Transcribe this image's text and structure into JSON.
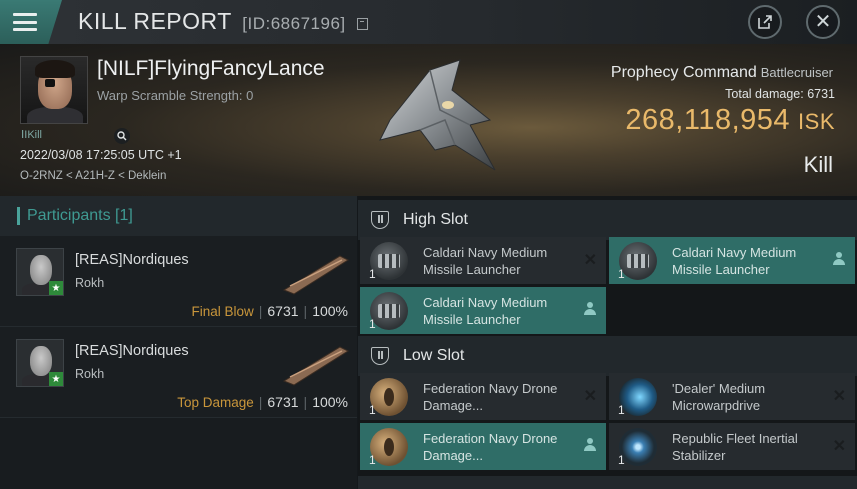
{
  "window": {
    "title": "KILL REPORT",
    "id_text": "[ID:6867196]",
    "icons": {
      "menu": "hamburger-icon",
      "share": "share-icon",
      "close": "close-icon",
      "copy": "copy-icon"
    }
  },
  "victim": {
    "name": "[NILF]FlyingFancyLance",
    "scramble": "Warp Scramble Strength: 0",
    "tag": "Kill",
    "date": "2022/03/08 17:25:05 UTC +1",
    "location": "O-2RNZ < A21H-Z < Deklein",
    "ship_name": "Prophecy Command",
    "ship_class": "Battlecruiser",
    "total_damage_label": "Total damage:",
    "total_damage": "6731",
    "isk_value": "268,118,954",
    "isk_unit": "ISK",
    "result": "Kill"
  },
  "participants": {
    "title": "Participants",
    "count": "[1]",
    "rows": [
      {
        "name": "[REAS]Nordiques",
        "ship": "Rokh",
        "tag": "Final Blow",
        "damage": "6731",
        "percent": "100%"
      },
      {
        "name": "[REAS]Nordiques",
        "ship": "Rokh",
        "tag": "Top Damage",
        "damage": "6731",
        "percent": "100%"
      }
    ]
  },
  "fitting": {
    "high_slot": {
      "title": "High Slot",
      "modules": [
        {
          "qty": "1",
          "name": "Caldari Navy Medium Missile Launcher",
          "state": "destroyed",
          "icon": "missile-launcher-icon"
        },
        {
          "qty": "1",
          "name": "Caldari Navy Medium Missile Launcher",
          "state": "dropped",
          "icon": "missile-launcher-icon"
        },
        {
          "qty": "1",
          "name": "Caldari Navy Medium Missile Launcher",
          "state": "dropped",
          "icon": "missile-launcher-icon"
        }
      ]
    },
    "low_slot": {
      "title": "Low Slot",
      "modules": [
        {
          "qty": "1",
          "name": "Federation Navy Drone Damage...",
          "state": "destroyed",
          "icon": "drone-damage-amplifier-icon"
        },
        {
          "qty": "1",
          "name": "'Dealer' Medium Microwarpdrive",
          "state": "destroyed",
          "icon": "microwarpdrive-icon"
        },
        {
          "qty": "1",
          "name": "Federation Navy Drone Damage...",
          "state": "dropped",
          "icon": "drone-damage-amplifier-icon"
        },
        {
          "qty": "1",
          "name": "Republic Fleet Inertial Stabilizer",
          "state": "destroyed",
          "icon": "inertial-stabilizer-icon"
        }
      ]
    }
  }
}
